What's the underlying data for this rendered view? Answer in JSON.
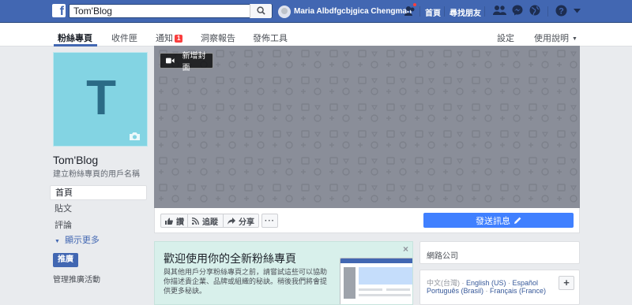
{
  "topbar": {
    "logo": "f",
    "search_value": "Tom'Blog",
    "user_name": "Maria Albdfgcbjgica Chengman",
    "home_label": "首頁",
    "find_friends_label": "尋找朋友"
  },
  "page_tabs": [
    {
      "label": "粉絲專頁"
    },
    {
      "label": "收件匣"
    },
    {
      "label": "通知",
      "badge": "1"
    },
    {
      "label": "洞察報告"
    },
    {
      "label": "發佈工具"
    }
  ],
  "page_tabs_right": {
    "settings_label": "設定",
    "help_label": "使用說明",
    "help_caret": "▼"
  },
  "profile": {
    "letter": "T",
    "name": "Tom'Blog",
    "username_prompt": "建立粉絲專頁的用戶名稱"
  },
  "left_nav": [
    {
      "label": "首頁"
    },
    {
      "label": "貼文"
    },
    {
      "label": "評論"
    }
  ],
  "show_more": {
    "arrow": "▼",
    "label": "顯示更多"
  },
  "promote": {
    "button_label": "推廣",
    "manage_label": "管理推廣活動"
  },
  "cover": {
    "add_cover_label": "新增封面"
  },
  "actions": {
    "like_label": "讚",
    "follow_label": "追蹤",
    "share_label": "分享",
    "more_label": "···",
    "send_message_label": "發送訊息"
  },
  "welcome": {
    "title": "歡迎使用你的全新粉絲專頁",
    "text": "與其他用戶分享粉絲專頁之前，請嘗試這些可以協助你描述貴企業、品牌或組織的秘訣。稍後我們將會提供更多秘訣。",
    "close": "×"
  },
  "category": {
    "label": "網路公司"
  },
  "languages": {
    "current": "中文(台灣)",
    "links_line1": [
      "English (US)",
      "Español"
    ],
    "links_line2": [
      "Português (Brasil)",
      "Français (France)"
    ],
    "separator": " · ",
    "plus": "+"
  },
  "colors": {
    "brand_blue": "#4267b2",
    "send_button": "#4080ff",
    "cover_bg": "#8a8e99",
    "profile_bg": "#83d4e3",
    "welcome_bg": "#d8f0eb",
    "badge_red": "#fa3e3e"
  },
  "icons": {
    "search": "search-icon",
    "friend_requests": "friend-requests-icon",
    "messenger": "messenger-icon",
    "notifications": "globe-icon",
    "help": "help-icon",
    "camera": "camera-icon",
    "video": "video-camera-icon",
    "like": "thumbs-up-icon",
    "follow": "rss-icon",
    "share": "share-arrow-icon",
    "edit": "pencil-icon"
  }
}
